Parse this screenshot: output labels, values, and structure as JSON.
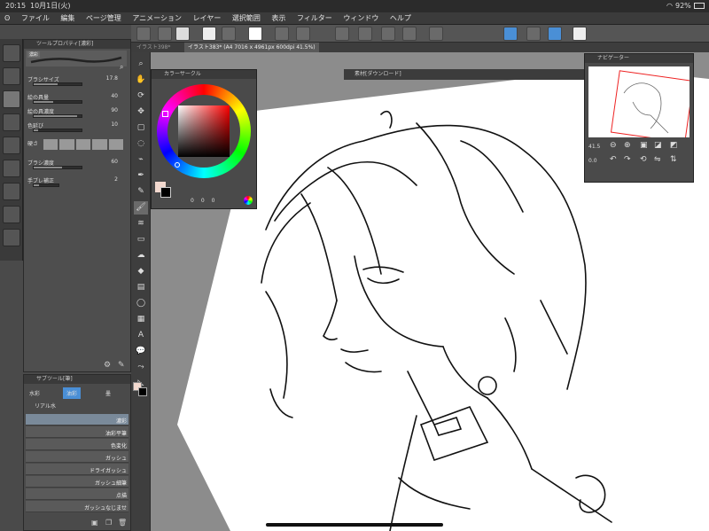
{
  "status": {
    "time": "20:15",
    "date": "10月1日(火)",
    "battery": "92%"
  },
  "menu": [
    "ファイル",
    "編集",
    "ページ管理",
    "アニメーション",
    "レイヤー",
    "選択範囲",
    "表示",
    "フィルター",
    "ウィンドウ",
    "ヘルプ"
  ],
  "tabs": [
    {
      "label": "イラスト398*"
    },
    {
      "label": "イラスト383* (A4 7016 x 4961px 600dpi 41.5%)"
    }
  ],
  "tool_property": {
    "title": "ツールプロパティ[濃彩]",
    "preset": "濃彩",
    "rows": [
      {
        "label": "ブラシサイズ",
        "value": "17.8",
        "fill": 0.5
      },
      {
        "label": "絵の具量",
        "value": "40",
        "fill": 0.4
      },
      {
        "label": "絵の具濃度",
        "value": "90",
        "fill": 0.9
      },
      {
        "label": "色延び",
        "value": "10",
        "fill": 0.1
      },
      {
        "label": "硬さ",
        "value": "",
        "fill": 0
      },
      {
        "label": "ブラシ濃度",
        "value": "60",
        "fill": 0.6
      },
      {
        "label": "手ブレ補正",
        "value": "2",
        "fill": 0.2
      }
    ]
  },
  "sub_tool": {
    "title": "サブツール[筆]",
    "tabs": [
      "水彩",
      "油彩",
      "墨"
    ],
    "group": "リアル水",
    "brushes": [
      "濃彩",
      "油彩平筆",
      "色変化",
      "ガッシュ",
      "ドライガッシュ",
      "ガッシュ細筆",
      "点描",
      "ガッシュなじませ"
    ]
  },
  "color_circle": {
    "title": "カラーサークル",
    "hsv": [
      "0",
      "0",
      "0"
    ]
  },
  "material": {
    "title": "素材[ダウンロード]"
  },
  "navigator": {
    "title": "ナビゲーター",
    "zoom": "41.5",
    "angle": "0.0"
  },
  "colors": {
    "accent": "#4a8fd6",
    "panel": "#4e4e4e",
    "bg": "#8c8c8c"
  }
}
